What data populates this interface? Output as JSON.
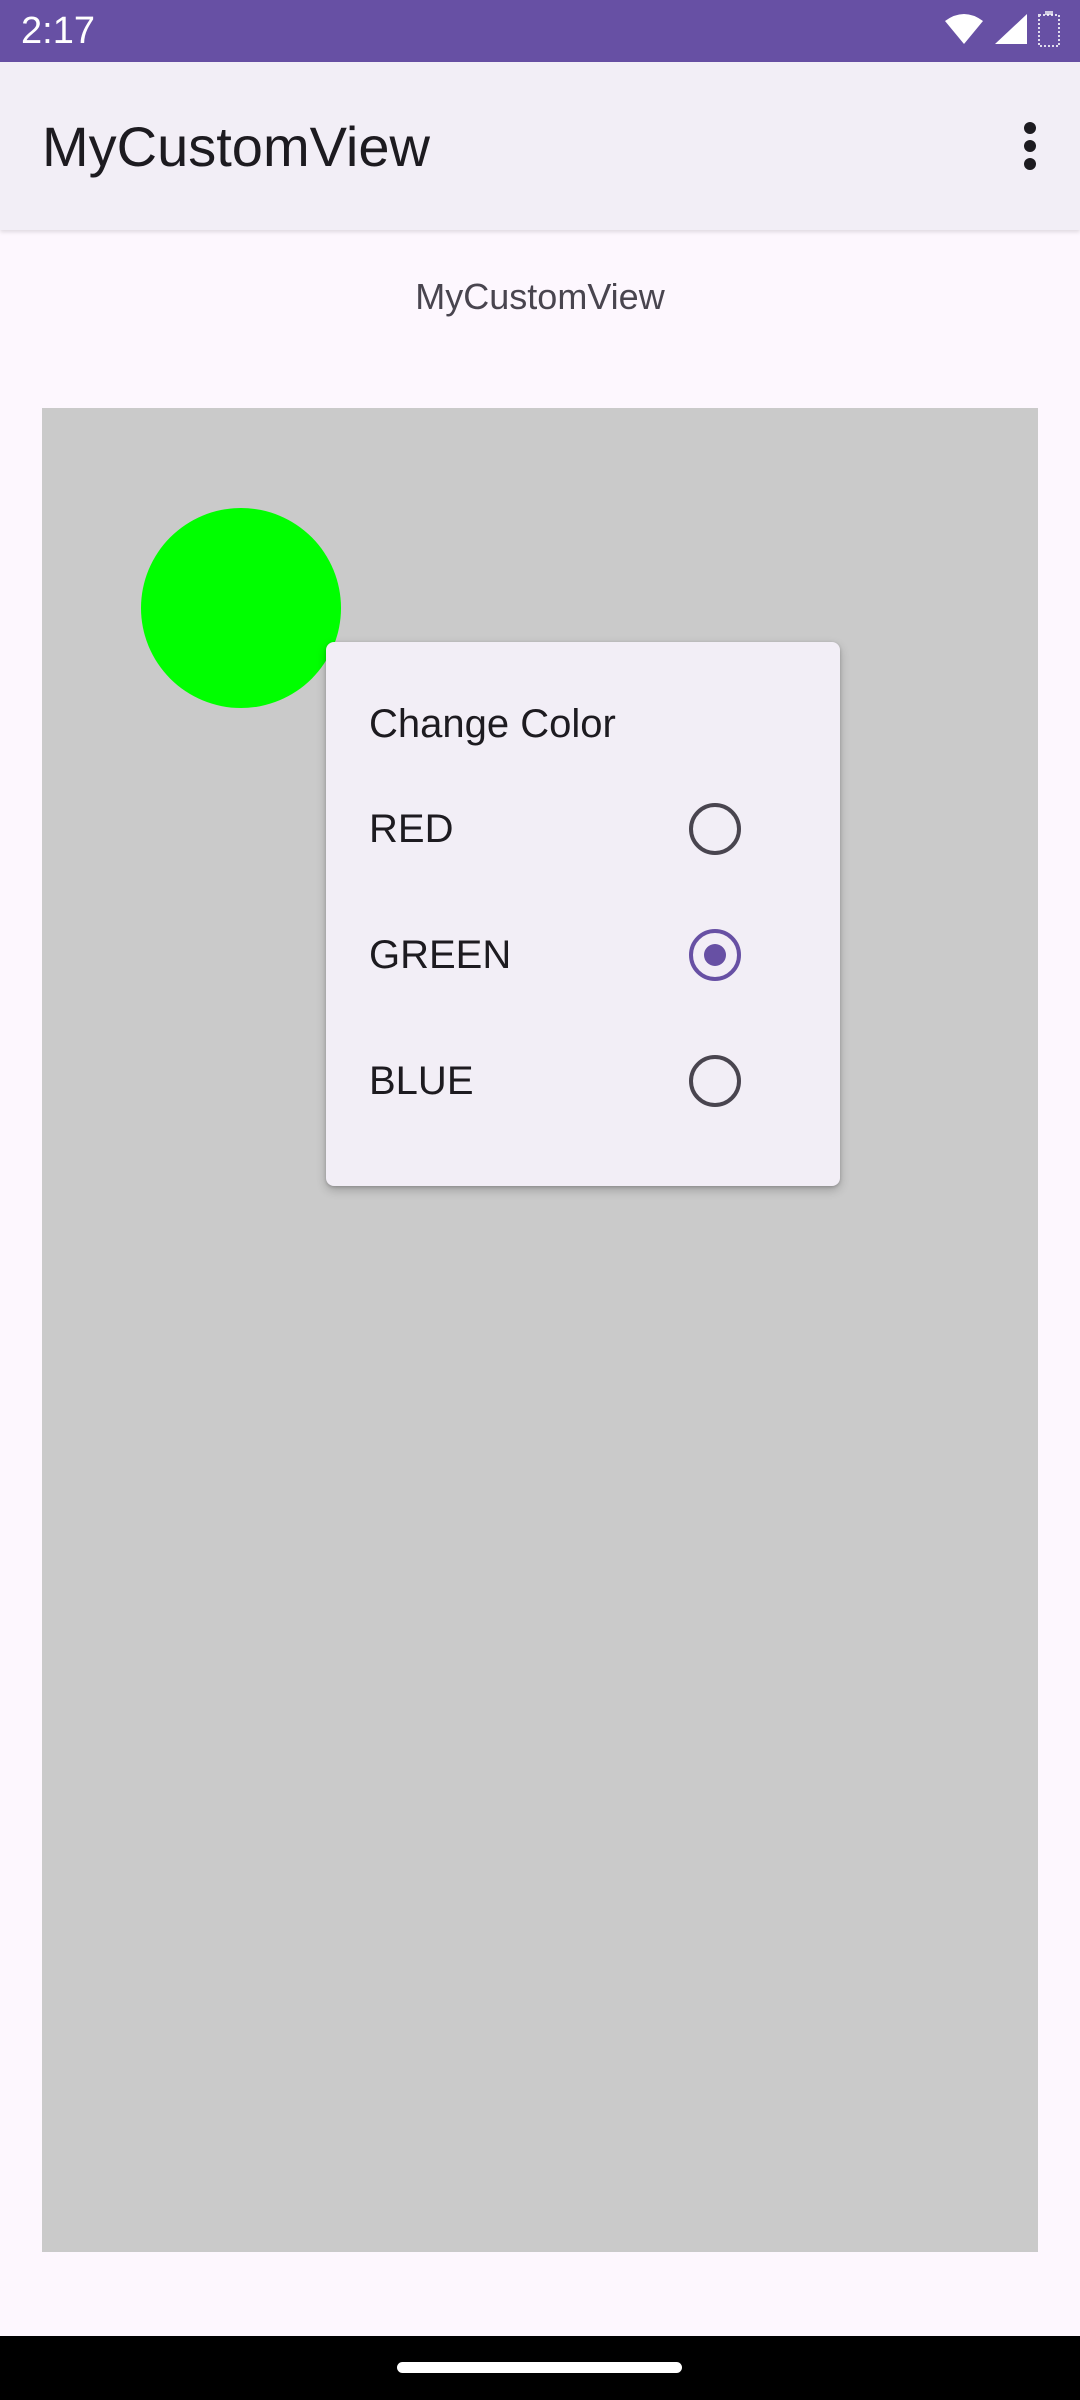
{
  "status_bar": {
    "time": "2:17",
    "icons": [
      "wifi-icon",
      "cellular-signal-icon",
      "battery-icon"
    ]
  },
  "app_bar": {
    "title": "MyCustomView",
    "overflow_icon": "more-vertical-icon"
  },
  "content": {
    "label": "MyCustomView",
    "canvas_color": "#cacaca",
    "circle_color": "#00ff00"
  },
  "popup_menu": {
    "title": "Change Color",
    "items": [
      {
        "label": "RED",
        "checked": false
      },
      {
        "label": "GREEN",
        "checked": true
      },
      {
        "label": "BLUE",
        "checked": false
      }
    ]
  },
  "colors": {
    "status_bar": "#6750a4",
    "app_bar": "#f2eef6",
    "accent": "#6750a4",
    "background": "#fdf7fe"
  },
  "nav_bar": {
    "handle": "home-gesture-handle"
  }
}
